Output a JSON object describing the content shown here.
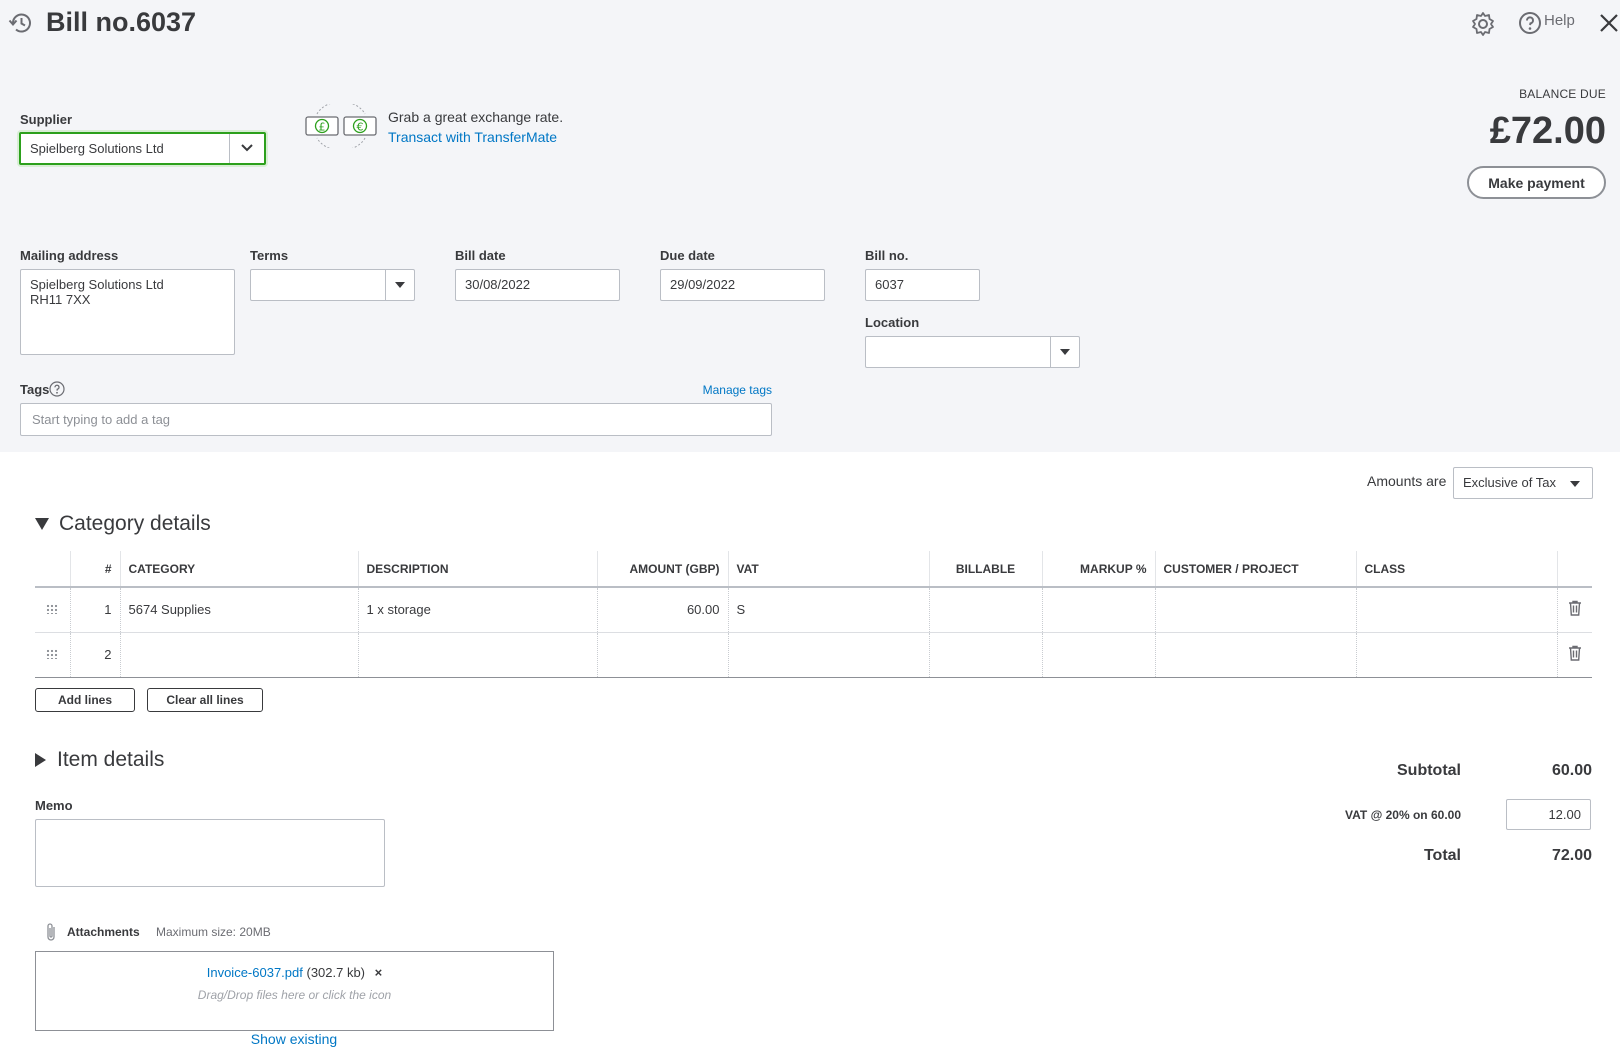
{
  "header": {
    "title": "Bill no.6037",
    "help_label": "Help"
  },
  "balance": {
    "label": "BALANCE DUE",
    "amount": "£72.00",
    "make_payment_label": "Make payment"
  },
  "supplier": {
    "label": "Supplier",
    "value": "Spielberg Solutions Ltd"
  },
  "promo": {
    "text": "Grab a great exchange rate.",
    "link": "Transact with TransferMate",
    "icon_left": "£",
    "icon_right": "€"
  },
  "mailing": {
    "label": "Mailing address",
    "line1": "Spielberg Solutions Ltd",
    "line2": "RH11 7XX"
  },
  "terms": {
    "label": "Terms",
    "value": ""
  },
  "bill_date": {
    "label": "Bill date",
    "value": "30/08/2022"
  },
  "due_date": {
    "label": "Due date",
    "value": "29/09/2022"
  },
  "bill_no": {
    "label": "Bill no.",
    "value": "6037"
  },
  "location": {
    "label": "Location",
    "value": ""
  },
  "tags": {
    "label": "Tags",
    "manage_label": "Manage tags",
    "placeholder": "Start typing to add a tag"
  },
  "amounts": {
    "label": "Amounts are",
    "value": "Exclusive of Tax"
  },
  "category": {
    "title": "Category details",
    "columns": [
      "#",
      "CATEGORY",
      "DESCRIPTION",
      "AMOUNT (GBP)",
      "VAT",
      "BILLABLE",
      "MARKUP %",
      "CUSTOMER / PROJECT",
      "CLASS"
    ],
    "rows": [
      {
        "num": "1",
        "category": "5674 Supplies",
        "description": "1 x storage",
        "amount": "60.00",
        "vat": "S"
      },
      {
        "num": "2",
        "category": "",
        "description": "",
        "amount": "",
        "vat": ""
      }
    ],
    "add_lines_label": "Add lines",
    "clear_lines_label": "Clear all lines"
  },
  "item": {
    "title": "Item details"
  },
  "memo": {
    "label": "Memo",
    "value": ""
  },
  "totals": {
    "subtotal_label": "Subtotal",
    "subtotal_value": "60.00",
    "vat_label": "VAT @ 20% on 60.00",
    "vat_value": "12.00",
    "total_label": "Total",
    "total_value": "72.00"
  },
  "attachments": {
    "label": "Attachments",
    "max_size": "Maximum size: 20MB",
    "file_name": "Invoice-6037.pdf",
    "file_size": "(302.7 kb)",
    "remove_glyph": "×",
    "drop_hint": "Drag/Drop files here or click the icon",
    "show_existing": "Show existing"
  },
  "colors": {
    "link": "#0077c5",
    "focus_border": "#2ca01c",
    "top_bg": "#f4f5f8",
    "text": "#393a3d"
  },
  "icons": [
    "history-icon",
    "gear-icon",
    "help-icon",
    "close-icon",
    "chevron-down-icon",
    "exchange-icon",
    "question-icon",
    "drag-handle-icon",
    "trash-icon",
    "paperclip-icon"
  ]
}
